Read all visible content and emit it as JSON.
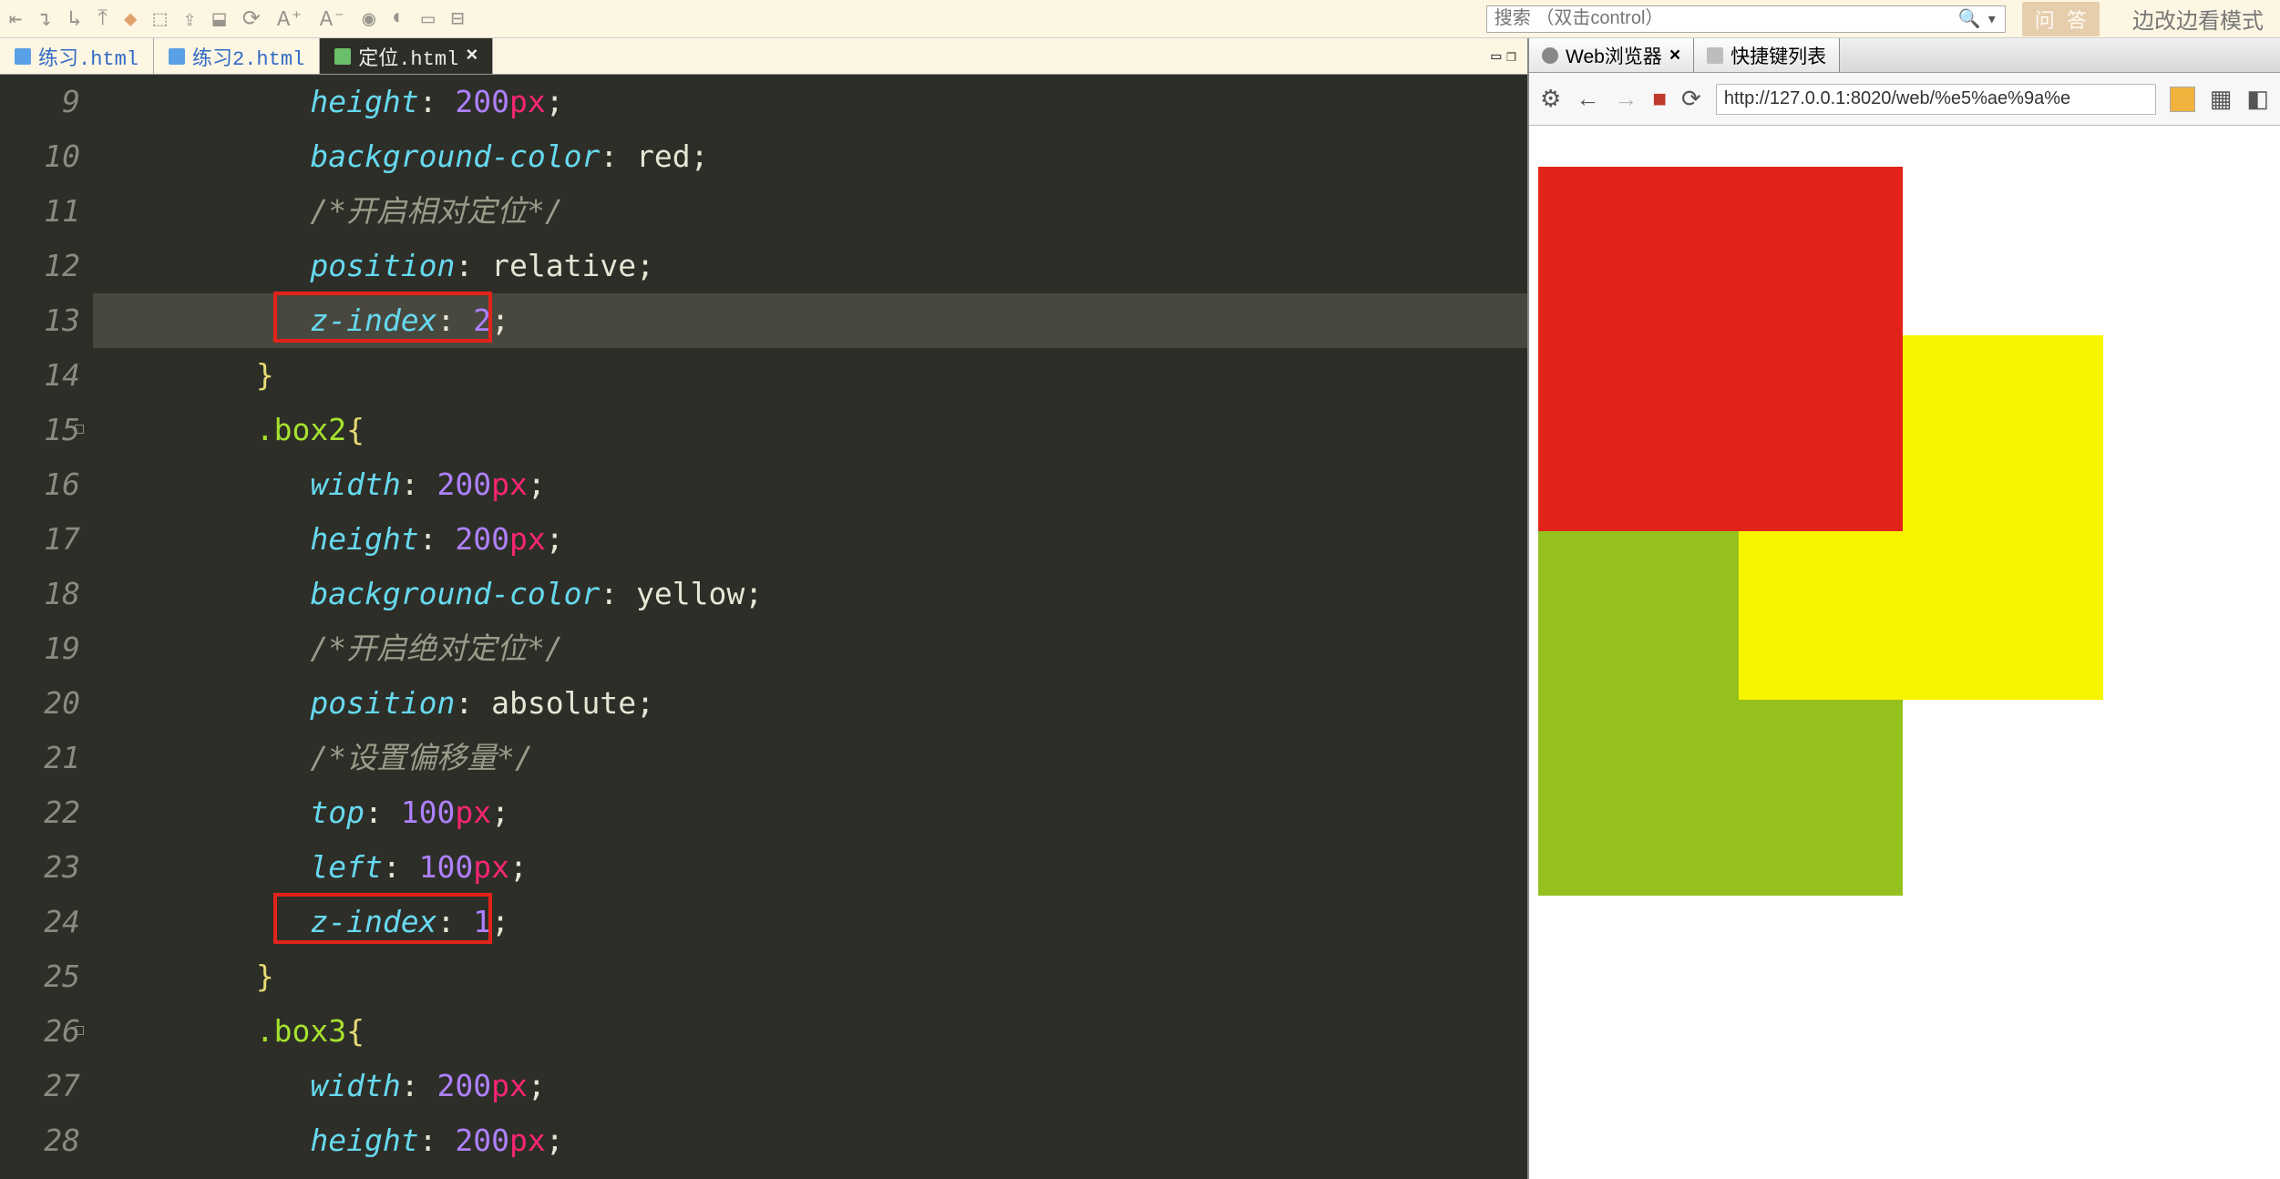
{
  "toolbar": {
    "search_placeholder": "搜索 （双击control）",
    "btn_label": "问 答",
    "mode_label": "边改边看模式"
  },
  "editor": {
    "tabs": [
      {
        "label": "练习.html"
      },
      {
        "label": "练习2.html"
      },
      {
        "label": "定位.html"
      }
    ],
    "lines": [
      {
        "num": "9",
        "indent": "            ",
        "parts": [
          [
            "prop",
            "height"
          ],
          [
            "punc",
            ": "
          ],
          [
            "num",
            "200"
          ],
          [
            "unit",
            "px"
          ],
          [
            "punc",
            ";"
          ]
        ]
      },
      {
        "num": "10",
        "indent": "            ",
        "parts": [
          [
            "prop",
            "background-color"
          ],
          [
            "punc",
            ": "
          ],
          [
            "val",
            "red"
          ],
          [
            "punc",
            ";"
          ]
        ]
      },
      {
        "num": "11",
        "indent": "            ",
        "parts": [
          [
            "cmt",
            "/*开启相对定位*/"
          ]
        ]
      },
      {
        "num": "12",
        "indent": "            ",
        "parts": [
          [
            "prop",
            "position"
          ],
          [
            "punc",
            ": "
          ],
          [
            "val",
            "relative"
          ],
          [
            "punc",
            ";"
          ]
        ]
      },
      {
        "num": "13",
        "indent": "            ",
        "parts": [
          [
            "prop",
            "z-index"
          ],
          [
            "punc",
            ": "
          ],
          [
            "num",
            "2"
          ],
          [
            "punc",
            ";"
          ]
        ],
        "current": true,
        "box": true
      },
      {
        "num": "14",
        "indent": "         ",
        "parts": [
          [
            "brace",
            "}"
          ]
        ]
      },
      {
        "num": "15",
        "indent": "         ",
        "parts": [
          [
            "sel",
            ".box2"
          ],
          [
            "brace",
            "{"
          ]
        ],
        "fold": true
      },
      {
        "num": "16",
        "indent": "            ",
        "parts": [
          [
            "prop",
            "width"
          ],
          [
            "punc",
            ": "
          ],
          [
            "num",
            "200"
          ],
          [
            "unit",
            "px"
          ],
          [
            "punc",
            ";"
          ]
        ]
      },
      {
        "num": "17",
        "indent": "            ",
        "parts": [
          [
            "prop",
            "height"
          ],
          [
            "punc",
            ": "
          ],
          [
            "num",
            "200"
          ],
          [
            "unit",
            "px"
          ],
          [
            "punc",
            ";"
          ]
        ]
      },
      {
        "num": "18",
        "indent": "            ",
        "parts": [
          [
            "prop",
            "background-color"
          ],
          [
            "punc",
            ": "
          ],
          [
            "val",
            "yellow"
          ],
          [
            "punc",
            ";"
          ]
        ]
      },
      {
        "num": "19",
        "indent": "            ",
        "parts": [
          [
            "cmt",
            "/*开启绝对定位*/"
          ]
        ]
      },
      {
        "num": "20",
        "indent": "            ",
        "parts": [
          [
            "prop",
            "position"
          ],
          [
            "punc",
            ": "
          ],
          [
            "val",
            "absolute"
          ],
          [
            "punc",
            ";"
          ]
        ]
      },
      {
        "num": "21",
        "indent": "            ",
        "parts": [
          [
            "cmt",
            "/*设置偏移量*/"
          ]
        ]
      },
      {
        "num": "22",
        "indent": "            ",
        "parts": [
          [
            "prop",
            "top"
          ],
          [
            "punc",
            ": "
          ],
          [
            "num",
            "100"
          ],
          [
            "unit",
            "px"
          ],
          [
            "punc",
            ";"
          ]
        ]
      },
      {
        "num": "23",
        "indent": "            ",
        "parts": [
          [
            "prop",
            "left"
          ],
          [
            "punc",
            ": "
          ],
          [
            "num",
            "100"
          ],
          [
            "unit",
            "px"
          ],
          [
            "punc",
            ";"
          ]
        ]
      },
      {
        "num": "24",
        "indent": "            ",
        "parts": [
          [
            "prop",
            "z-index"
          ],
          [
            "punc",
            ": "
          ],
          [
            "num",
            "1"
          ],
          [
            "punc",
            ";"
          ]
        ],
        "box": true
      },
      {
        "num": "25",
        "indent": "         ",
        "parts": [
          [
            "brace",
            "}"
          ]
        ]
      },
      {
        "num": "26",
        "indent": "         ",
        "parts": [
          [
            "sel",
            ".box3"
          ],
          [
            "brace",
            "{"
          ]
        ],
        "fold": true
      },
      {
        "num": "27",
        "indent": "            ",
        "parts": [
          [
            "prop",
            "width"
          ],
          [
            "punc",
            ": "
          ],
          [
            "num",
            "200"
          ],
          [
            "unit",
            "px"
          ],
          [
            "punc",
            ";"
          ]
        ]
      },
      {
        "num": "28",
        "indent": "            ",
        "parts": [
          [
            "prop",
            "height"
          ],
          [
            "punc",
            ": "
          ],
          [
            "num",
            "200"
          ],
          [
            "unit",
            "px"
          ],
          [
            "punc",
            ";"
          ]
        ]
      }
    ]
  },
  "preview": {
    "tabs": [
      {
        "label": "Web浏览器"
      },
      {
        "label": "快捷键列表"
      }
    ],
    "url": "http://127.0.0.1:8020/web/%e5%ae%9a%e"
  }
}
